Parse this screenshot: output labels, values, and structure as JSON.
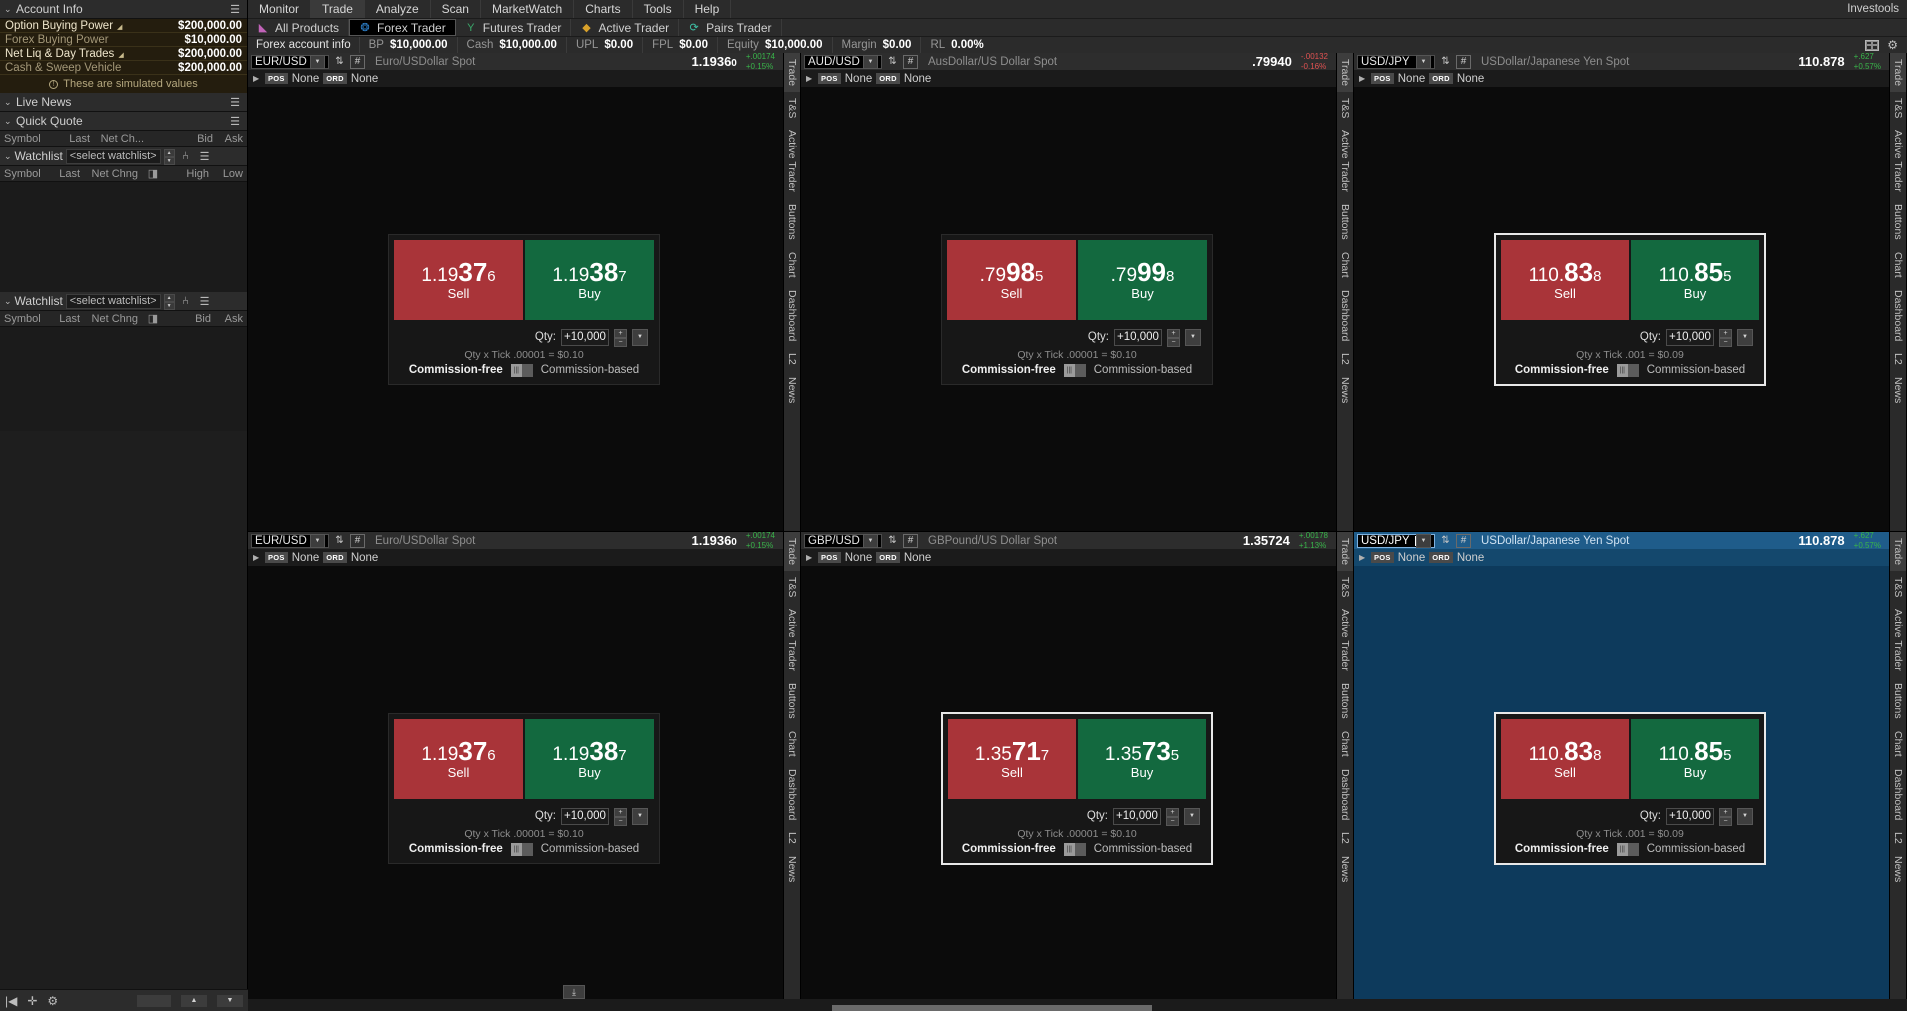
{
  "sidebar": {
    "account_info": {
      "title": "Account Info",
      "caret": "⌄",
      "menu_icon": "list-icon",
      "rows": [
        {
          "label": "Option Buying Power",
          "has_tri": true,
          "value": "$200,000.00",
          "bright": true
        },
        {
          "label": "Forex Buying Power",
          "has_tri": false,
          "value": "$10,000.00",
          "bright": false
        },
        {
          "label": "Net Liq & Day Trades",
          "has_tri": true,
          "value": "$200,000.00",
          "bright": true
        },
        {
          "label": "Cash & Sweep Vehicle",
          "has_tri": false,
          "value": "$200,000.00",
          "bright": false
        }
      ],
      "note": "These are simulated values",
      "note_icon": "info-icon"
    },
    "live_news": {
      "title": "Live News",
      "caret": "⌄",
      "menu_icon": "list-icon"
    },
    "quick_quote": {
      "title": "Quick Quote",
      "caret": "⌄",
      "menu_icon": "list-icon",
      "columns": [
        "Symbol",
        "Last",
        "Net Ch...",
        "Bid",
        "Ask"
      ]
    },
    "watchlist_1": {
      "title": "Watchlist",
      "caret": "⌄",
      "selector_value": "<select watchlist>",
      "chart_icon": "chart-icon",
      "menu_icon": "list-icon",
      "columns": [
        "Symbol",
        "Last",
        "Net Chng",
        "",
        "High",
        "Low"
      ]
    },
    "watchlist_2": {
      "title": "Watchlist",
      "caret": "⌄",
      "selector_value": "<select watchlist>",
      "chart_icon": "chart-icon",
      "menu_icon": "list-icon",
      "columns": [
        "Symbol",
        "Last",
        "Net Chng",
        "",
        "Bid",
        "Ask"
      ]
    },
    "footer": {
      "first_icon": "skip-start-icon",
      "add_icon": "plus-icon",
      "gear_icon": "gear-icon",
      "up_icon": "caret-up-icon",
      "down_icon": "caret-down-icon"
    }
  },
  "header": {
    "menu_items": [
      {
        "label": "Monitor",
        "active": false
      },
      {
        "label": "Trade",
        "active": true
      },
      {
        "label": "Analyze",
        "active": false
      },
      {
        "label": "Scan",
        "active": false
      },
      {
        "label": "MarketWatch",
        "active": false
      },
      {
        "label": "Charts",
        "active": false
      },
      {
        "label": "Tools",
        "active": false
      },
      {
        "label": "Help",
        "active": false
      }
    ],
    "right_label": "Investools",
    "sub_tabs": [
      {
        "label": "All Products",
        "icon": "triangle-pink-icon",
        "selected": false,
        "color": "#c163b8"
      },
      {
        "label": "Forex Trader",
        "icon": "forex-blue-icon",
        "selected": true,
        "color": "#2f86d4"
      },
      {
        "label": "Futures Trader",
        "icon": "futures-green-icon",
        "selected": false,
        "color": "#3aa86a"
      },
      {
        "label": "Active Trader",
        "icon": "diamond-orange-icon",
        "selected": false,
        "color": "#d9a12a"
      },
      {
        "label": "Pairs Trader",
        "icon": "pairs-teal-icon",
        "selected": false,
        "color": "#3ec1a6"
      }
    ],
    "account_bar": {
      "label": "Forex account info",
      "items": [
        {
          "key": "BP",
          "value": "$10,000.00"
        },
        {
          "key": "Cash",
          "value": "$10,000.00"
        },
        {
          "key": "UPL",
          "value": "$0.00"
        },
        {
          "key": "FPL",
          "value": "$0.00"
        },
        {
          "key": "Equity",
          "value": "$10,000.00"
        },
        {
          "key": "Margin",
          "value": "$0.00"
        },
        {
          "key": "RL",
          "value": "0.00%"
        }
      ],
      "layout_icon": "grid-layout-icon",
      "gear_icon": "gear-icon"
    }
  },
  "vertical_tabs": [
    "Trade",
    "T&S",
    "Active Trader",
    "Buttons",
    "Chart",
    "Dashboard",
    "L2",
    "News"
  ],
  "labels": {
    "sell": "Sell",
    "buy": "Buy",
    "qty_label": "Qty:",
    "commission_free": "Commission-free",
    "commission_based": "Commission-based",
    "pos_tag": "POS",
    "ord_tag": "ORD",
    "none": "None",
    "gear_icon": "gear-icon",
    "expand_icon": "caret-right-icon",
    "swap_icon": "swap-icon",
    "hash_icon": "hash-icon",
    "dropdown_icon": "chevron-down-icon",
    "plus_icon": "plus-icon",
    "minus_icon": "minus-icon",
    "menu_icon": "list-icon"
  },
  "panels": [
    {
      "symbol": "EUR/USD",
      "description": "Euro/USDollar Spot",
      "last": "1.1936",
      "last_sub": "0",
      "change": "+.00174",
      "change_pct": "+0.15%",
      "change_dir": "up",
      "sell_price": {
        "pre": "1.19",
        "big": "37",
        "post": "6"
      },
      "buy_price": {
        "pre": "1.19",
        "big": "38",
        "post": "7"
      },
      "qty": "+10,000",
      "tick_text": "Qty x Tick .00001 = $0.10",
      "focused": false,
      "editing": false
    },
    {
      "symbol": "AUD/USD",
      "description": "AusDollar/US Dollar Spot",
      "last": ".79940",
      "last_sub": "",
      "change": "-.00132",
      "change_pct": "-0.16%",
      "change_dir": "down",
      "sell_price": {
        "pre": ".79",
        "big": "98",
        "post": "5"
      },
      "buy_price": {
        "pre": ".79",
        "big": "99",
        "post": "8"
      },
      "qty": "+10,000",
      "tick_text": "Qty x Tick .00001 = $0.10",
      "focused": false,
      "editing": false
    },
    {
      "symbol": "USD/JPY",
      "description": "USDollar/Japanese Yen Spot",
      "last": "110.878",
      "last_sub": "",
      "change": "+.627",
      "change_pct": "+0.57%",
      "change_dir": "up",
      "sell_price": {
        "pre": "110.",
        "big": "83",
        "post": "8"
      },
      "buy_price": {
        "pre": "110.",
        "big": "85",
        "post": "5"
      },
      "qty": "+10,000",
      "tick_text": "Qty x Tick .001 = $0.09",
      "focused": false,
      "editing": false
    },
    {
      "symbol": "EUR/USD",
      "description": "Euro/USDollar Spot",
      "last": "1.1936",
      "last_sub": "0",
      "change": "+.00174",
      "change_pct": "+0.15%",
      "change_dir": "up",
      "sell_price": {
        "pre": "1.19",
        "big": "37",
        "post": "6"
      },
      "buy_price": {
        "pre": "1.19",
        "big": "38",
        "post": "7"
      },
      "qty": "+10,000",
      "tick_text": "Qty x Tick .00001 = $0.10",
      "focused": false,
      "editing": false
    },
    {
      "symbol": "GBP/USD",
      "description": "GBPound/US Dollar Spot",
      "last": "1.35724",
      "last_sub": "",
      "change": "+.00178",
      "change_pct": "+1.13%",
      "change_dir": "up",
      "sell_price": {
        "pre": "1.35",
        "big": "71",
        "post": "7"
      },
      "buy_price": {
        "pre": "1.35",
        "big": "73",
        "post": "5"
      },
      "qty": "+10,000",
      "tick_text": "Qty x Tick .00001 = $0.10",
      "focused": false,
      "editing": false
    },
    {
      "symbol": "USD/JPY",
      "description": "USDollar/Japanese Yen Spot",
      "last": "110.878",
      "last_sub": "",
      "change": "+.627",
      "change_pct": "+0.57%",
      "change_dir": "up",
      "sell_price": {
        "pre": "110.",
        "big": "83",
        "post": "8"
      },
      "buy_price": {
        "pre": "110.",
        "big": "85",
        "post": "5"
      },
      "qty": "+10,000",
      "tick_text": "Qty x Tick .001 = $0.09",
      "focused": true,
      "editing": true
    }
  ],
  "colors": {
    "sell_red": "#a93439",
    "buy_green": "#13693f",
    "accent_blue": "#0d3a5c",
    "up_green": "#39b54a",
    "down_red": "#e05252",
    "account_bg": "#241d0e"
  }
}
